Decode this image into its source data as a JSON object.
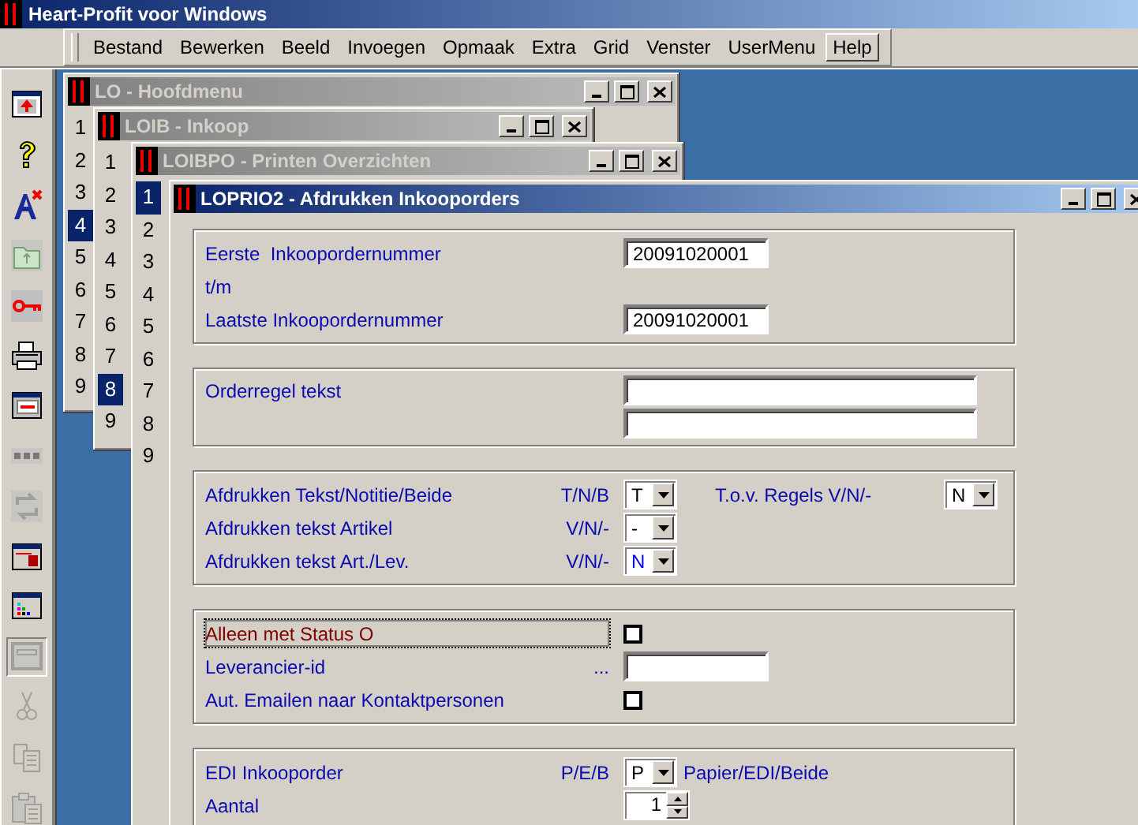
{
  "app": {
    "title": "Heart-Profit voor Windows"
  },
  "menu": [
    {
      "label": "Bestand",
      "selected": false
    },
    {
      "label": "Bewerken",
      "selected": false
    },
    {
      "label": "Beeld",
      "selected": false
    },
    {
      "label": "Invoegen",
      "selected": false
    },
    {
      "label": "Opmaak",
      "selected": false
    },
    {
      "label": "Extra",
      "selected": false
    },
    {
      "label": "Grid",
      "selected": false
    },
    {
      "label": "Venster",
      "selected": false
    },
    {
      "label": "UserMenu",
      "selected": false
    },
    {
      "label": "Help",
      "selected": true
    }
  ],
  "toolbar": [
    {
      "kind": "window-arrow",
      "disabled": false,
      "pressed": false
    },
    {
      "kind": "help",
      "disabled": false,
      "pressed": false
    },
    {
      "kind": "font-delete",
      "disabled": false,
      "pressed": false
    },
    {
      "kind": "folder",
      "disabled": true,
      "pressed": false
    },
    {
      "kind": "key",
      "disabled": false,
      "pressed": false
    },
    {
      "kind": "printer",
      "disabled": false,
      "pressed": false
    },
    {
      "kind": "window-form",
      "disabled": false,
      "pressed": false
    },
    {
      "kind": "dots",
      "disabled": true,
      "pressed": false
    },
    {
      "kind": "refresh",
      "disabled": true,
      "pressed": false
    },
    {
      "kind": "window-lock",
      "disabled": false,
      "pressed": false
    },
    {
      "kind": "window-chart",
      "disabled": false,
      "pressed": false
    },
    {
      "kind": "window",
      "disabled": true,
      "pressed": true
    },
    {
      "kind": "scissors",
      "disabled": true,
      "pressed": false
    },
    {
      "kind": "copy",
      "disabled": true,
      "pressed": false
    },
    {
      "kind": "paste",
      "disabled": true,
      "pressed": false
    }
  ],
  "windows": [
    {
      "title": "LO - Hoofdmenu",
      "active": false,
      "items": [
        {
          "label": "1",
          "selected": false
        },
        {
          "label": "2",
          "selected": false
        },
        {
          "label": "3",
          "selected": false
        },
        {
          "label": "4",
          "selected": true
        },
        {
          "label": "5",
          "selected": false
        },
        {
          "label": "6",
          "selected": false
        },
        {
          "label": "7",
          "selected": false
        },
        {
          "label": "8",
          "selected": false
        },
        {
          "label": "9",
          "selected": false
        }
      ]
    },
    {
      "title": "LOIB - Inkoop",
      "active": false,
      "items": [
        {
          "label": "1",
          "selected": false
        },
        {
          "label": "2",
          "selected": false
        },
        {
          "label": "3",
          "selected": false
        },
        {
          "label": "4",
          "selected": false
        },
        {
          "label": "5",
          "selected": false
        },
        {
          "label": "6",
          "selected": false
        },
        {
          "label": "7",
          "selected": false
        },
        {
          "label": "8",
          "selected": true
        },
        {
          "label": "9",
          "selected": false
        }
      ]
    },
    {
      "title": "LOIBPO - Printen Overzichten",
      "active": false,
      "items": [
        {
          "label": "1",
          "selected": true
        },
        {
          "label": "2",
          "selected": false
        },
        {
          "label": "3",
          "selected": false
        },
        {
          "label": "4",
          "selected": false
        },
        {
          "label": "5",
          "selected": false
        },
        {
          "label": "6",
          "selected": false
        },
        {
          "label": "7",
          "selected": false
        },
        {
          "label": "8",
          "selected": false
        },
        {
          "label": "9",
          "selected": false
        }
      ]
    },
    {
      "title": "LOPRIO2 - Afdrukken Inkooporders",
      "active": true,
      "form": [
        {
          "rows": [
            {
              "label": "Eerste  Inkoopordernummer",
              "control": {
                "kind": "text",
                "value": "20091020001"
              }
            },
            {
              "label": "t/m"
            },
            {
              "label": "Laatste Inkoopordernummer",
              "control": {
                "kind": "text",
                "value": "20091020001"
              }
            }
          ]
        },
        {
          "rows": [
            {
              "label": "Orderregel tekst",
              "control": {
                "kind": "multiline"
              }
            }
          ]
        },
        {
          "rows": [
            {
              "label": "Afdrukken Tekst/Notitie/Beide",
              "code": "T/N/B",
              "control": {
                "kind": "dropdown",
                "value": "T",
                "highlight": false
              },
              "extra": {
                "label": "T.o.v. Regels V/N/-",
                "control": {
                  "kind": "dropdown",
                  "value": "N",
                  "highlight": false
                }
              }
            },
            {
              "label": "Afdrukken tekst Artikel",
              "code": "V/N/-",
              "control": {
                "kind": "dropdown",
                "value": "-",
                "highlight": false
              }
            },
            {
              "label": "Afdrukken tekst Art./Lev.",
              "code": "V/N/-",
              "control": {
                "kind": "dropdown",
                "value": "N",
                "highlight": true
              }
            }
          ]
        },
        {
          "rows": [
            {
              "label": "Alleen met Status O",
              "focused": true,
              "control": {
                "kind": "checkbox",
                "checked": false
              }
            },
            {
              "label": "Leverancier-id",
              "code": "...",
              "control": {
                "kind": "text"
              }
            },
            {
              "label": "Aut. Emailen naar Kontaktpersonen",
              "control": {
                "kind": "checkbox",
                "checked": false
              }
            }
          ]
        },
        {
          "rows": [
            {
              "label": "EDI Inkooporder",
              "code": "P/E/B",
              "control": {
                "kind": "dropdown",
                "value": "P",
                "highlight": false
              },
              "note": "Papier/EDI/Beide"
            },
            {
              "label": "Aantal",
              "control": {
                "kind": "spinner",
                "value": "1"
              }
            }
          ]
        }
      ]
    }
  ]
}
